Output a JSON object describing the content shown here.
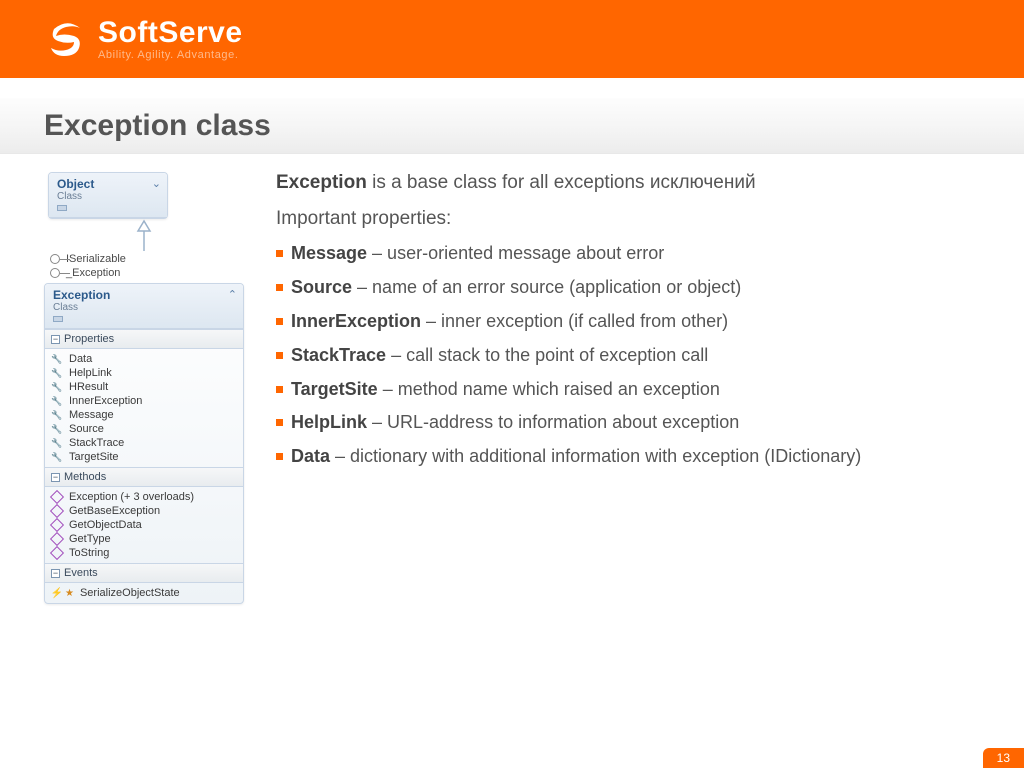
{
  "brand": {
    "name": "SoftServe",
    "tagline": "Ability. Agility. Advantage."
  },
  "slide": {
    "title": "Exception class",
    "page_number": "13",
    "intro_strong": "Exception",
    "intro_rest": " is a base class for all exceptions исключений",
    "sub_heading": "Important properties:",
    "bullets": [
      {
        "term": "Message",
        "desc": " – user-oriented message about error"
      },
      {
        "term": "Source",
        "desc": " – name of an error source (application or object)"
      },
      {
        "term": "InnerException",
        "desc": " – inner exception (if called from other)"
      },
      {
        "term": "StackTrace",
        "desc": " – call stack to the point of exception call"
      },
      {
        "term": "TargetSite",
        "desc": " – method name which raised an exception"
      },
      {
        "term": "HelpLink",
        "desc": " – URL-address to information about exception"
      },
      {
        "term": "Data",
        "desc": " – dictionary with additional information with exception (IDictionary)"
      }
    ]
  },
  "diagram": {
    "object_box": {
      "name": "Object",
      "kind": "Class"
    },
    "interfaces": [
      "ISerializable",
      "_Exception"
    ],
    "exception_box": {
      "name": "Exception",
      "kind": "Class"
    },
    "sections": {
      "properties_label": "Properties",
      "methods_label": "Methods",
      "events_label": "Events"
    },
    "properties": [
      "Data",
      "HelpLink",
      "HResult",
      "InnerException",
      "Message",
      "Source",
      "StackTrace",
      "TargetSite"
    ],
    "methods": [
      "Exception (+ 3 overloads)",
      "GetBaseException",
      "GetObjectData",
      "GetType",
      "ToString"
    ],
    "events": [
      "SerializeObjectState"
    ]
  }
}
